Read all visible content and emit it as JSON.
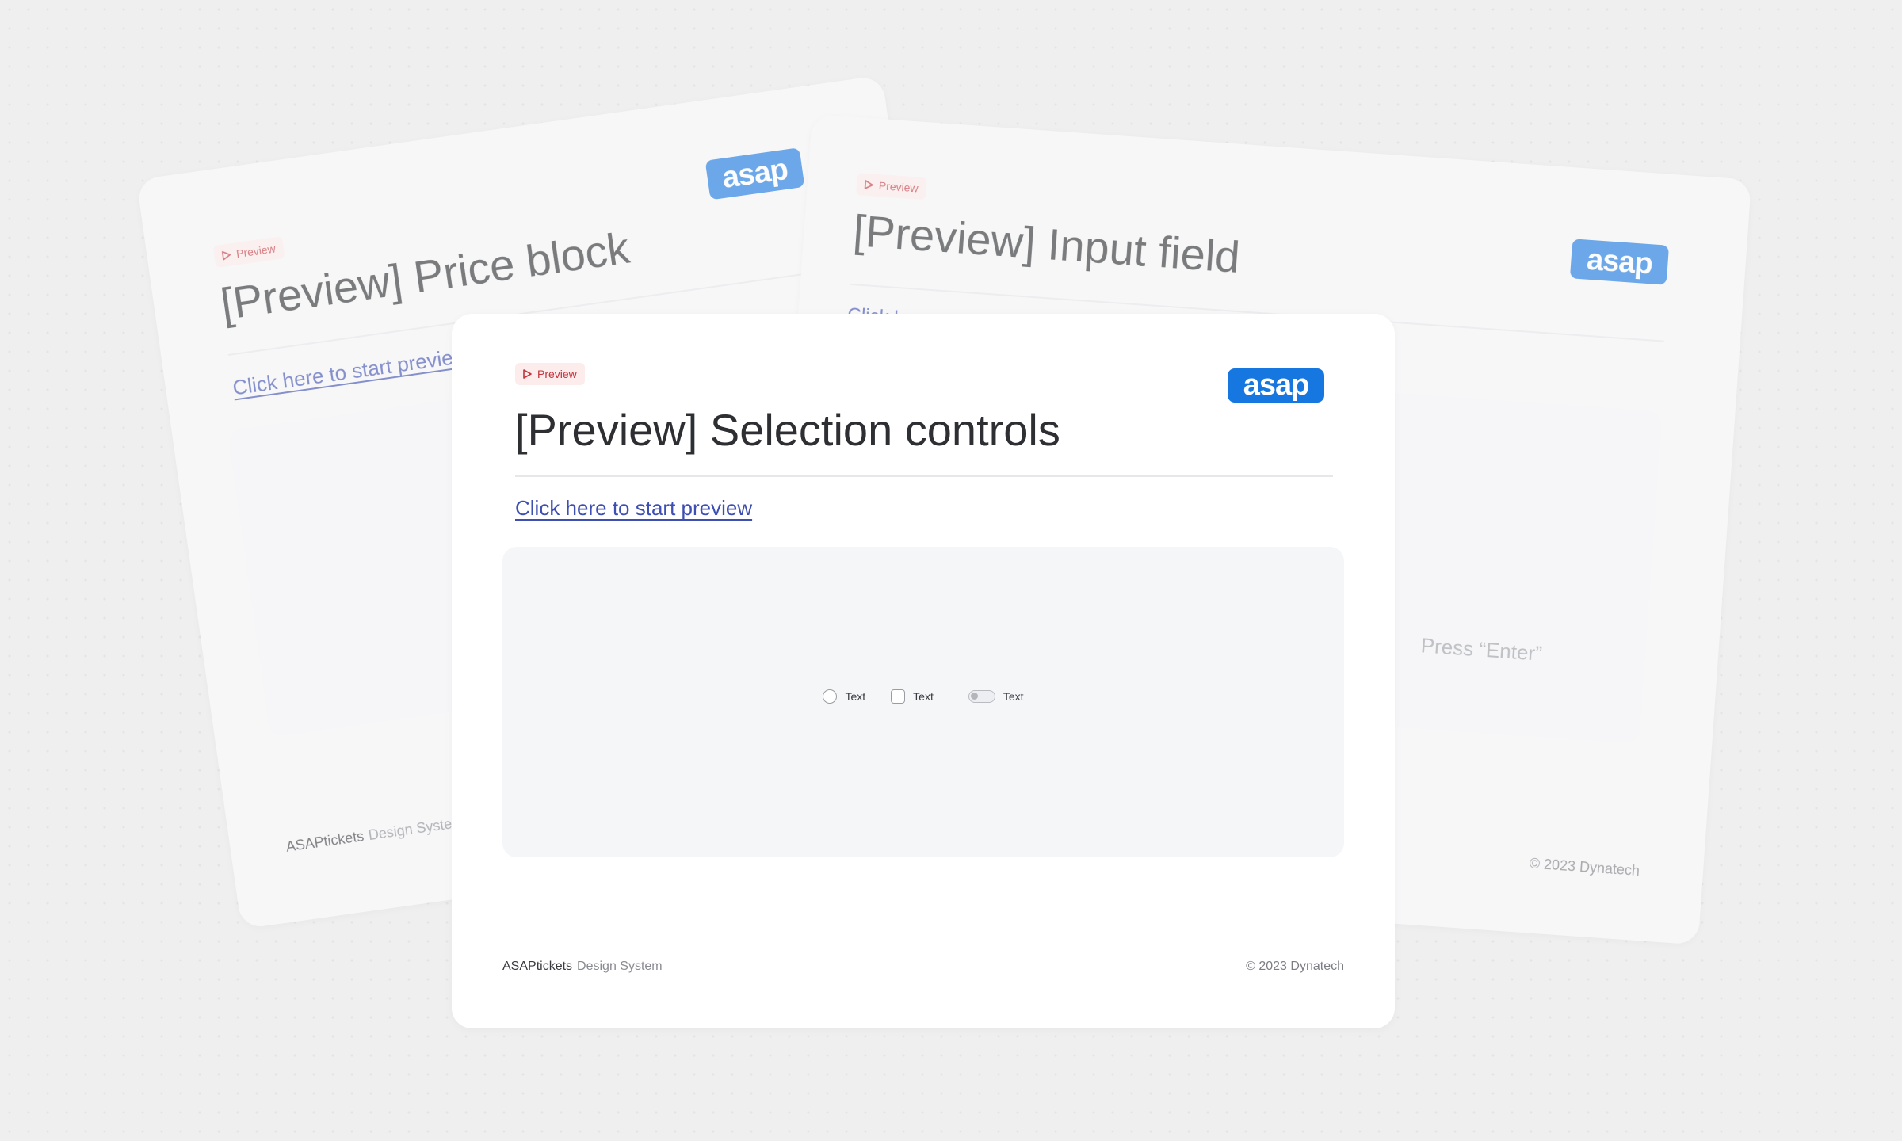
{
  "background_color": "#efefef",
  "accent_color": "#1677e0",
  "badge": {
    "label": "Preview",
    "color": "#c4343c",
    "bg": "#fdecec"
  },
  "logo": {
    "text": "asap"
  },
  "cards": {
    "left": {
      "title": "[Preview] Price block",
      "link": "Click here to start preview",
      "footer_brand": "ASAPtickets",
      "footer_sub": "Design System"
    },
    "right": {
      "title": "[Preview] Input field",
      "link": "Click here to start preview",
      "hint": "Press “Enter”",
      "footer_copy": "© 2023 Dynatech"
    },
    "main": {
      "title": "[Preview] Selection controls",
      "link": "Click here to start preview",
      "controls": [
        {
          "type": "radio",
          "label": "Text"
        },
        {
          "type": "checkbox",
          "label": "Text"
        },
        {
          "type": "toggle",
          "label": "Text"
        }
      ],
      "footer_brand": "ASAPtickets",
      "footer_sub": "Design System",
      "footer_copy": "© 2023 Dynatech"
    }
  }
}
